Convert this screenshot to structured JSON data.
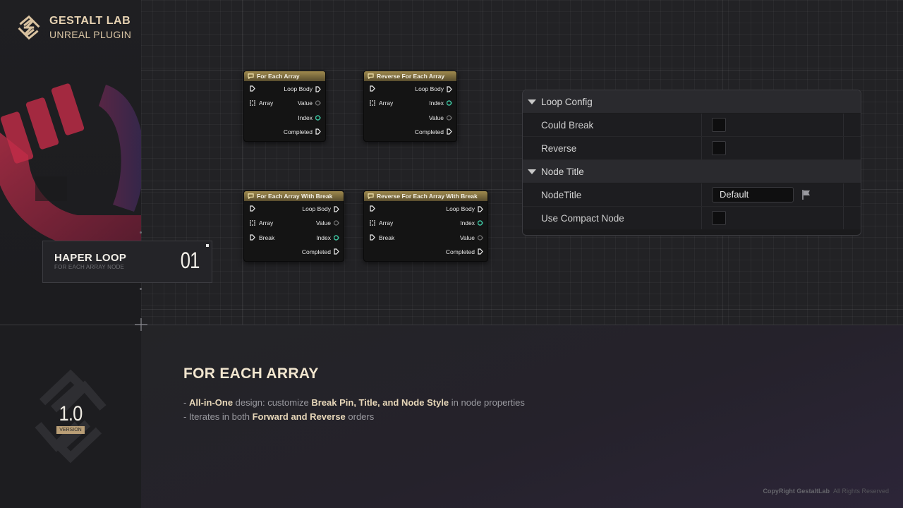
{
  "brand": {
    "name": "GESTALT LAB",
    "sub": "UNREAL PLUGIN",
    "logo_icon": "gestalt-knot-logo"
  },
  "nodes": [
    {
      "title": "For Each Array",
      "left": [
        {
          "label": "",
          "pin": "exec"
        },
        {
          "label": "Array",
          "pin": "array"
        }
      ],
      "right": [
        {
          "label": "Loop Body",
          "pin": "exec"
        },
        {
          "label": "Value",
          "pin": "value"
        },
        {
          "label": "Index",
          "pin": "index"
        },
        {
          "label": "Completed",
          "pin": "exec"
        }
      ]
    },
    {
      "title": "Reverse For Each Array",
      "left": [
        {
          "label": "",
          "pin": "exec"
        },
        {
          "label": "Array",
          "pin": "array"
        }
      ],
      "right": [
        {
          "label": "Loop Body",
          "pin": "exec"
        },
        {
          "label": "Index",
          "pin": "index"
        },
        {
          "label": "Value",
          "pin": "value"
        },
        {
          "label": "Completed",
          "pin": "exec"
        }
      ]
    },
    {
      "title": "For Each Array With Break",
      "left": [
        {
          "label": "",
          "pin": "exec"
        },
        {
          "label": "Array",
          "pin": "array"
        },
        {
          "label": "Break",
          "pin": "exec"
        }
      ],
      "right": [
        {
          "label": "Loop Body",
          "pin": "exec"
        },
        {
          "label": "Value",
          "pin": "value"
        },
        {
          "label": "Index",
          "pin": "index"
        },
        {
          "label": "Completed",
          "pin": "exec"
        }
      ]
    },
    {
      "title": "Reverse For Each Array With Break",
      "left": [
        {
          "label": "",
          "pin": "exec"
        },
        {
          "label": "Array",
          "pin": "array"
        },
        {
          "label": "Break",
          "pin": "exec"
        }
      ],
      "right": [
        {
          "label": "Loop Body",
          "pin": "exec"
        },
        {
          "label": "Index",
          "pin": "index"
        },
        {
          "label": "Value",
          "pin": "value"
        },
        {
          "label": "Completed",
          "pin": "exec"
        }
      ]
    }
  ],
  "details": {
    "cat1": "Loop Config",
    "could_break": "Could Break",
    "reverse": "Reverse",
    "cat2": "Node Title",
    "node_title": "NodeTitle",
    "node_title_value": "Default",
    "use_compact": "Use Compact Node"
  },
  "card": {
    "title": "HAPER LOOP",
    "sub": "FOR EACH ARRAY NODE",
    "number": "01"
  },
  "section": {
    "title": "FOR EACH ARRAY",
    "b1_pre": "- ",
    "b1_bold1": "All-in-One",
    "b1_mid": " design: customize ",
    "b1_bold2": "Break Pin, Title, and Node Style",
    "b1_post": " in node properties",
    "b2_pre": "- Iterates in both ",
    "b2_bold": "Forward and Reverse",
    "b2_post": " orders"
  },
  "version": {
    "number": "1.0",
    "label": "VERSION"
  },
  "copyright": {
    "bold": "CopyRight GestaltLab",
    "rest": "All Rights Reserved"
  },
  "colors": {
    "accent_gold": "#e6d2b2",
    "node_header": "#a08a4e",
    "pin_green": "#3ec3a0",
    "hero_red": "#c0304a"
  }
}
